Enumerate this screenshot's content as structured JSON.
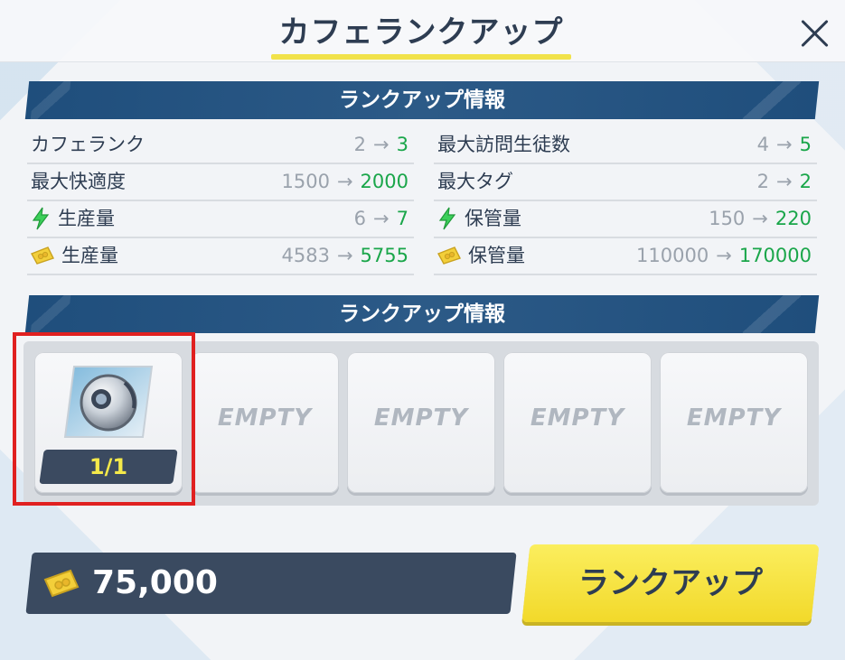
{
  "header": {
    "title": "カフェランクアップ"
  },
  "sections": {
    "info_title": "ランクアップ情報",
    "materials_title": "ランクアップ情報"
  },
  "stats": {
    "left": [
      {
        "label": "カフェランク",
        "icon": null,
        "old": "2",
        "new": "3"
      },
      {
        "label": "最大快適度",
        "icon": null,
        "old": "1500",
        "new": "2000"
      },
      {
        "label": "生産量",
        "icon": "bolt-icon",
        "old": "6",
        "new": "7"
      },
      {
        "label": "生産量",
        "icon": "credit-coin-icon",
        "old": "4583",
        "new": "5755"
      }
    ],
    "right": [
      {
        "label": "最大訪問生徒数",
        "icon": null,
        "old": "4",
        "new": "5"
      },
      {
        "label": "最大タグ",
        "icon": null,
        "old": "2",
        "new": "2"
      },
      {
        "label": "保管量",
        "icon": "bolt-icon",
        "old": "150",
        "new": "220"
      },
      {
        "label": "保管量",
        "icon": "credit-coin-icon",
        "old": "110000",
        "new": "170000"
      }
    ],
    "arrow": "→"
  },
  "materials": {
    "slots": [
      {
        "type": "item",
        "icon": "core-orb-item-icon",
        "count": "1/1"
      },
      {
        "type": "empty",
        "label": "EMPTY"
      },
      {
        "type": "empty",
        "label": "EMPTY"
      },
      {
        "type": "empty",
        "label": "EMPTY"
      },
      {
        "type": "empty",
        "label": "EMPTY"
      }
    ]
  },
  "cost": {
    "icon": "credit-coin-icon",
    "amount": "75,000"
  },
  "actions": {
    "rankup_label": "ランクアップ"
  },
  "colors": {
    "banner": "#1f4e7c",
    "increase": "#1aa64a",
    "button": "#f2d92a",
    "highlight": "#e02020"
  }
}
